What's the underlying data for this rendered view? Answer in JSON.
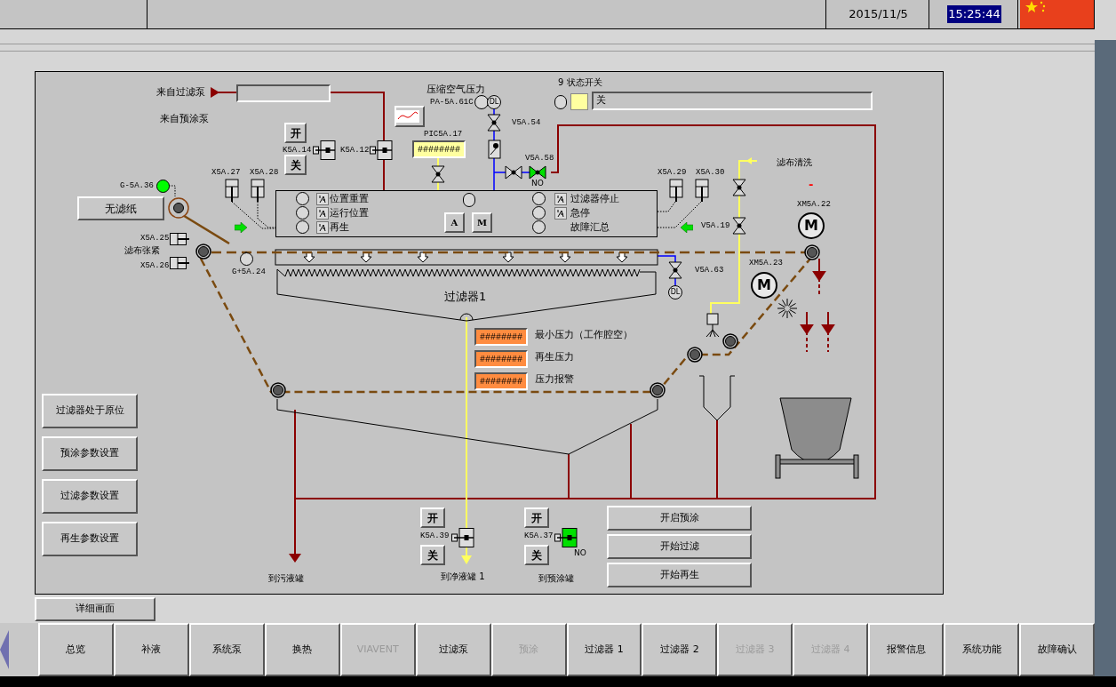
{
  "top_bar": {
    "date": "2015/11/5",
    "time": "15:25:44"
  },
  "inlets": [
    "来自过滤泵",
    "来自预涂泵"
  ],
  "paper_sensor": {
    "label": "G-5A.36",
    "on": true
  },
  "no_paper_button": "无滤纸",
  "tension": {
    "label": "滤布张紧",
    "cylinders": [
      "X5A.25",
      "X5A.26"
    ]
  },
  "belt_sensor": {
    "label": "G+5A.24",
    "on": false
  },
  "cylinders_left": [
    "X5A.27",
    "X5A.28"
  ],
  "cylinders_right": [
    "X5A.29",
    "X5A.30"
  ],
  "inlet_valve": {
    "open_button": "开",
    "close_button": "关",
    "tag": "K5A.14",
    "open": false
  },
  "valve_k512": {
    "tag": "K5A.12",
    "open": false
  },
  "pressure_controller": {
    "tag": "PIC5A.17",
    "value": "########"
  },
  "air": {
    "title": "压缩空气压力",
    "tag": "PA-5A.61C",
    "dl": "DL",
    "valve": "V5A.54"
  },
  "valve_v558": {
    "tag": "V5A.58",
    "open": true,
    "note": "NO"
  },
  "status_switch": {
    "number": "9",
    "title": "状态开关",
    "value": "关"
  },
  "control_panel": {
    "left": [
      {
        "label": "位置重置",
        "switch": true
      },
      {
        "label": "运行位置",
        "switch": true
      },
      {
        "label": "再生",
        "switch": true
      }
    ],
    "right": [
      {
        "label": "过滤器停止",
        "switch": true
      },
      {
        "label": "急停",
        "switch": true
      },
      {
        "label": "故障汇总",
        "switch": false
      }
    ],
    "mode_buttons": [
      "A",
      "M"
    ]
  },
  "wash": {
    "label": "滤布清洗",
    "valve": "V5A.19"
  },
  "drain_valve": {
    "tag": "V5A.63",
    "dl": "DL"
  },
  "motors": [
    {
      "tag": "XM5A.22",
      "symbol": "M"
    },
    {
      "tag": "XM5A.23",
      "symbol": "M"
    }
  ],
  "motor_indicator": "-",
  "filter_title": "过滤器1",
  "pressures": [
    {
      "value": "########",
      "label": "最小压力（工作腔空）"
    },
    {
      "value": "########",
      "label": "再生压力"
    },
    {
      "value": "########",
      "label": "压力报警"
    }
  ],
  "side_buttons": [
    "过滤器处于原位",
    "预涂参数设置",
    "过滤参数设置",
    "再生参数设置"
  ],
  "outlet_valves": [
    {
      "tag": "K5A.39",
      "open_button": "开",
      "close_button": "关",
      "open": false
    },
    {
      "tag": "K5A.37",
      "open_button": "开",
      "close_button": "关",
      "open": true,
      "note": "NO"
    }
  ],
  "outlets": [
    "到污液罐",
    "到净液罐 1",
    "到预涂罐"
  ],
  "action_buttons": [
    "开启预涂",
    "开始过滤",
    "开始再生"
  ],
  "detail_button": "详细画面",
  "nav": [
    {
      "label": "总览",
      "disabled": false
    },
    {
      "label": "补液",
      "disabled": false
    },
    {
      "label": "系统泵",
      "disabled": false
    },
    {
      "label": "换热",
      "disabled": false
    },
    {
      "label": "VIAVENT",
      "disabled": true
    },
    {
      "label": "过滤泵",
      "disabled": false
    },
    {
      "label": "预涂",
      "disabled": true
    },
    {
      "label": "过滤器 1",
      "disabled": false
    },
    {
      "label": "过滤器 2",
      "disabled": false
    },
    {
      "label": "过滤器 3",
      "disabled": true
    },
    {
      "label": "过滤器 4",
      "disabled": true
    },
    {
      "label": "报警信息",
      "disabled": false
    },
    {
      "label": "系统功能",
      "disabled": false
    },
    {
      "label": "故障确认",
      "disabled": false
    }
  ]
}
